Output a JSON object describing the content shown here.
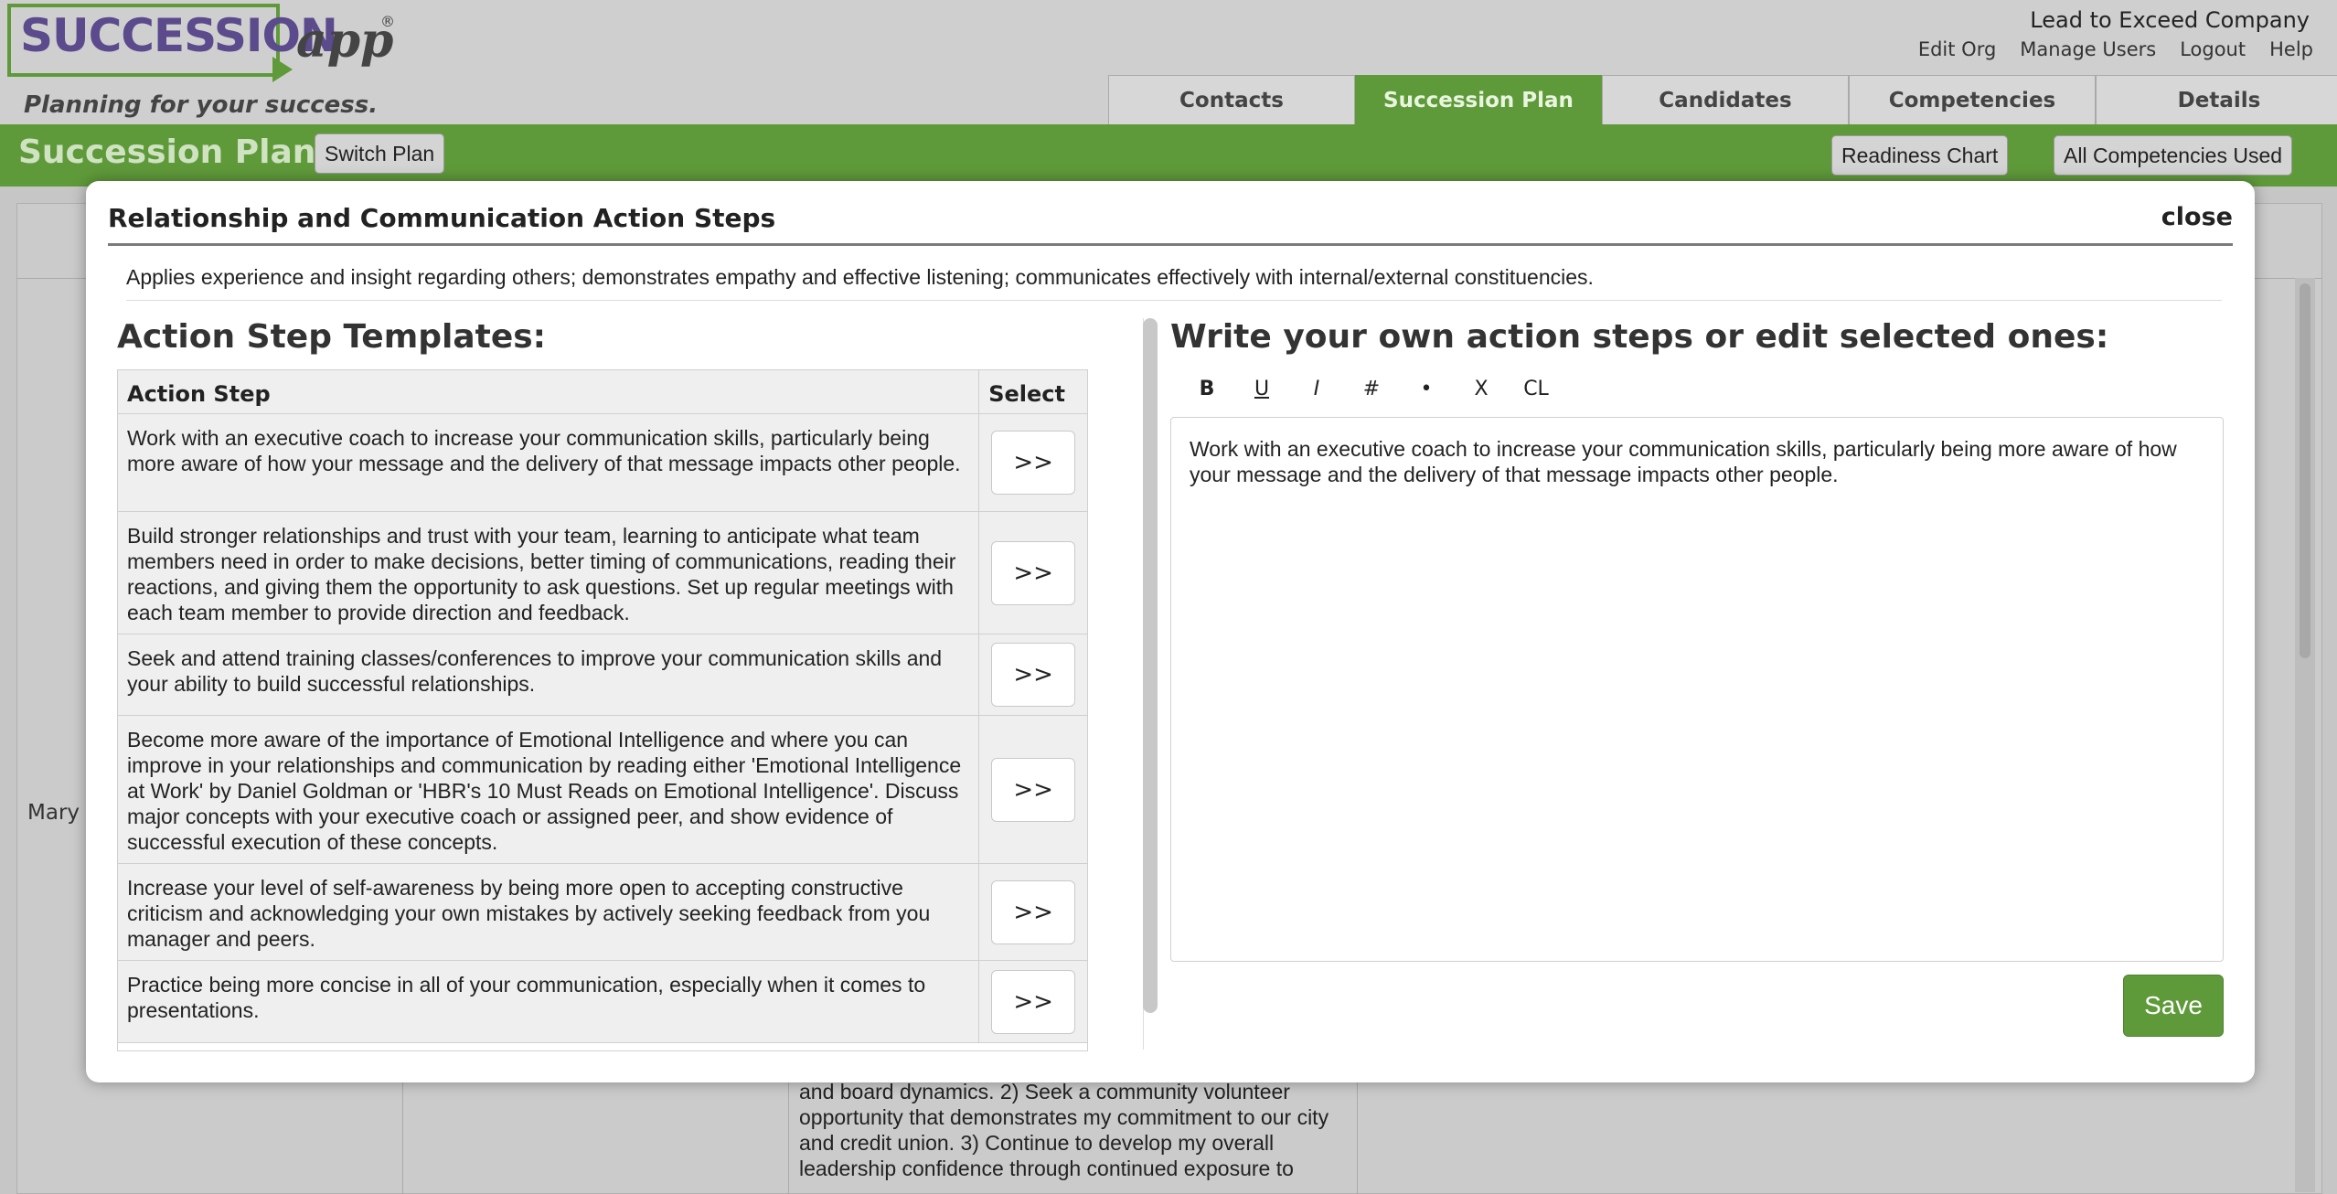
{
  "brand": {
    "logo_text": "SUCCESSION",
    "logo_app": "app",
    "logo_reg": "®",
    "tagline": "Planning for your success."
  },
  "header": {
    "company": "Lead to Exceed Company",
    "links": [
      "Edit Org",
      "Manage Users",
      "Logout",
      "Help"
    ],
    "tabs": [
      "Contacts",
      "Succession Plan",
      "Candidates",
      "Competencies",
      "Details"
    ],
    "active_tab": "Succession Plan"
  },
  "subheader": {
    "title": "Succession Plan",
    "switch_plan": "Switch Plan",
    "readiness_chart": "Readiness Chart",
    "all_competencies": "All Competencies Used"
  },
  "background": {
    "row_name": "Mary ",
    "text": "and board dynamics. 2) Seek a community volunteer opportunity that demonstrates my commitment to our city and credit union. 3) Continue to develop my overall leadership confidence through continued exposure to"
  },
  "modal": {
    "title": "Relationship and Communication Action Steps",
    "close": "close",
    "description": "Applies experience and insight regarding others; demonstrates empathy and effective listening; communicates effectively with internal/external constituencies.",
    "left_heading": "Action Step Templates:",
    "right_heading": "Write your own action steps or edit selected ones:",
    "col_action": "Action Step",
    "col_select": "Select",
    "select_label": ">>",
    "steps": [
      "Work with an executive coach to increase your communication skills, particularly being more aware of how your message and the delivery of that message impacts other people.",
      "Build stronger relationships and trust with your team, learning to anticipate what team members need in order to make decisions, better timing of communications, reading their reactions, and giving them the opportunity to ask questions. Set up regular meetings with each team member to provide direction and feedback.",
      "Seek and attend training classes/conferences to improve your communication skills and your ability to build successful relationships.",
      "Become more aware of the importance of Emotional Intelligence and where you can improve in your relationships and communication by reading either 'Emotional Intelligence at Work' by Daniel Goldman or 'HBR's 10 Must Reads on Emotional Intelligence'. Discuss major concepts with your executive coach or assigned peer, and show evidence of successful execution of these concepts.",
      "Increase your level of self-awareness by being more open to accepting constructive criticism and acknowledging your own mistakes by actively seeking feedback from you manager and peers.",
      "Practice being more concise in all of your communication, especially when it comes to presentations."
    ],
    "toolbar": {
      "bold": "B",
      "underline": "U",
      "italic": "I",
      "numbered": "#",
      "bullet": "•",
      "clear": "X",
      "clear_list": "CL"
    },
    "editor_text": "Work with an executive coach to increase your communication skills, particularly being more aware of how your message and the delivery of that message impacts other people.",
    "save": "Save"
  },
  "colors": {
    "brand_green": "#5f9a3a",
    "logo_purple": "#5b4a8c"
  }
}
